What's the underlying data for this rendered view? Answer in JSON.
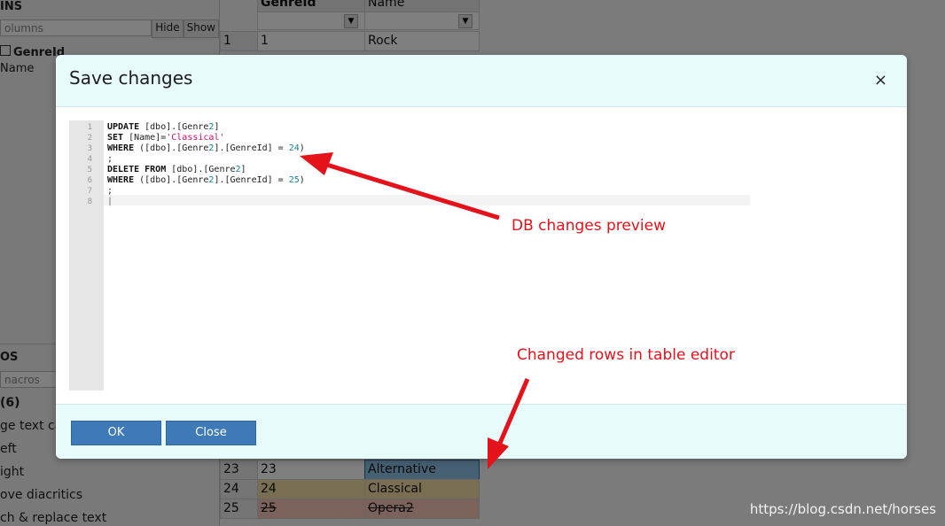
{
  "left_panel": {
    "columns_header": "INS",
    "columns_filter_placeholder": "olumns",
    "hide_label": "Hide",
    "show_label": "Show",
    "column_items": [
      "GenreId",
      "Name"
    ],
    "macros_header": "OS",
    "macros_filter_placeholder": "nacros",
    "macro_items": [
      "(6)",
      "ge text ca",
      "eft",
      "ight",
      "ove diacritics",
      "ch & replace text"
    ]
  },
  "grid": {
    "columns": [
      "GenreId",
      "Name"
    ],
    "rows": [
      {
        "num": "1",
        "genreid": "1",
        "name": "Rock",
        "state": "normal"
      },
      {
        "num": "23",
        "genreid": "23",
        "name": "Alternative",
        "state": "selected"
      },
      {
        "num": "24",
        "genreid": "24",
        "name": "Classical",
        "state": "modified"
      },
      {
        "num": "25",
        "genreid": "25",
        "name": "Opera2",
        "state": "deleted"
      }
    ]
  },
  "modal": {
    "title": "Save changes",
    "close_symbol": "×",
    "ok_label": "OK",
    "close_label": "Close",
    "line_numbers": [
      "1",
      "2",
      "3",
      "4",
      "5",
      "6",
      "7",
      "8"
    ]
  },
  "annotations": {
    "preview_label": "DB changes preview",
    "rows_label": "Changed rows in table editor",
    "arrow_color": "#e3121b"
  },
  "watermark": "https://blog.csdn.net/horses"
}
